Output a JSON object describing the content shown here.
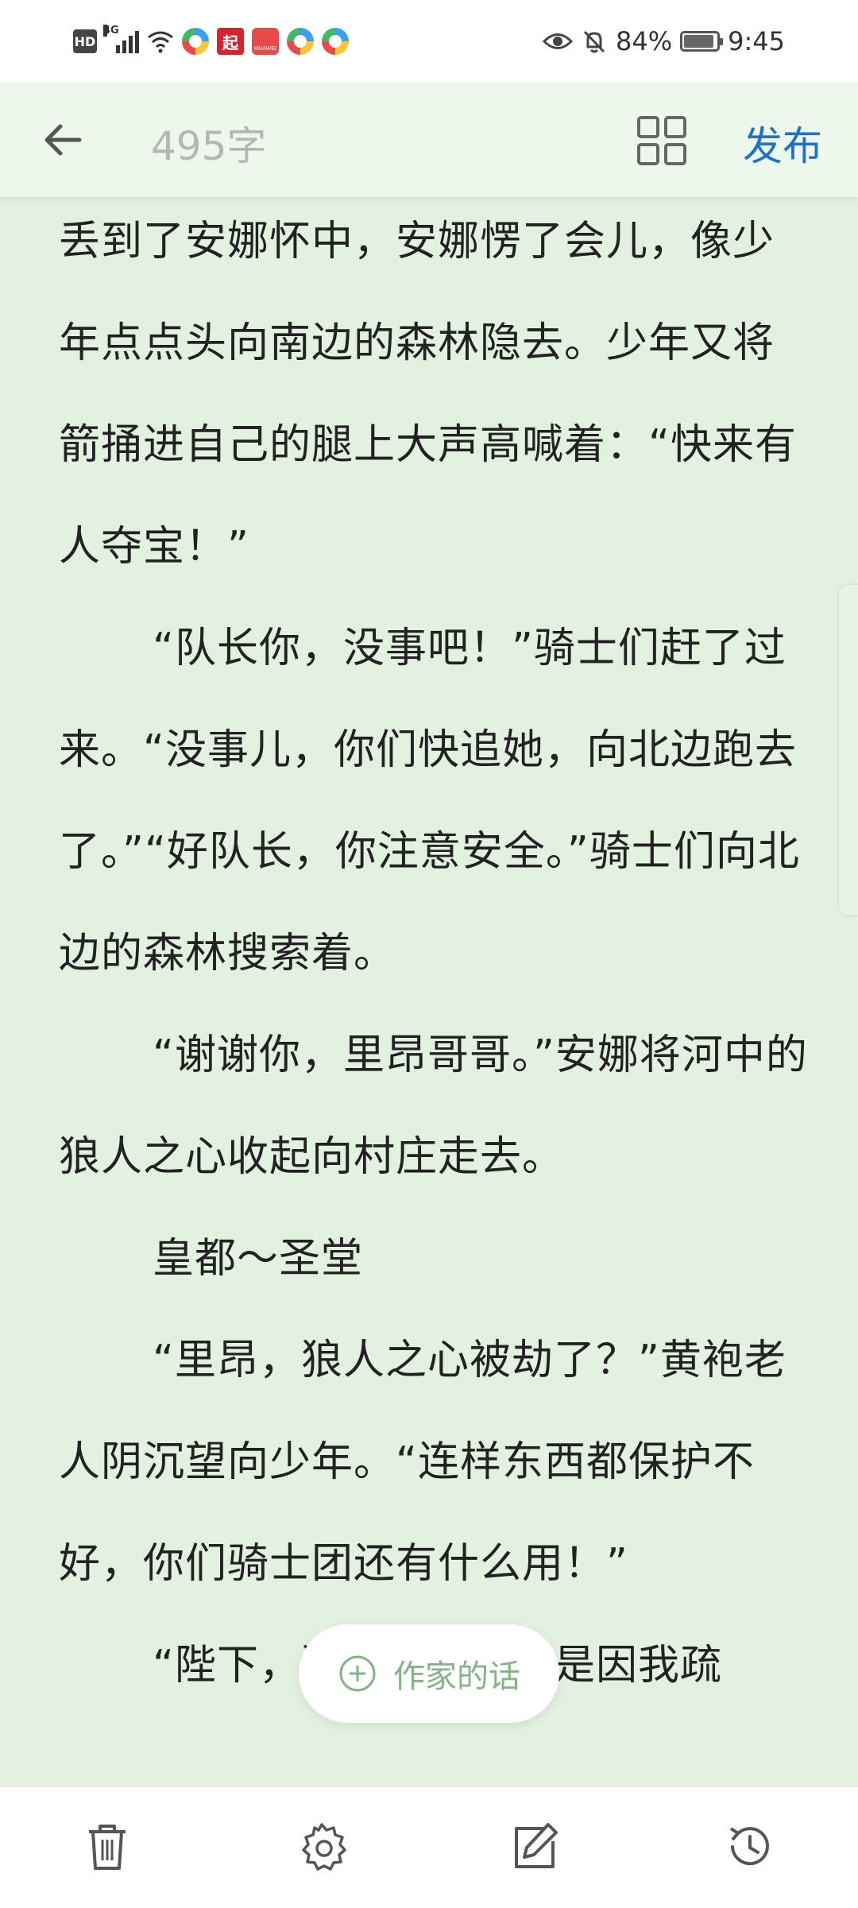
{
  "status_bar": {
    "left_icons": [
      "hd-icon",
      "signal-4g-icon",
      "wifi-icon",
      "app-icon",
      "qidian-app-icon",
      "huawei-app-icon",
      "app-icon",
      "app-icon"
    ],
    "signal_tag": "4G",
    "hd_label": "HD",
    "qidian_label": "起",
    "huawei_label": "HUAWEI",
    "battery": "84%",
    "time": "9:45",
    "right_icons": [
      "eye-icon",
      "bell-off-icon",
      "battery-icon"
    ]
  },
  "toolbar": {
    "word_count": "495字",
    "publish_label": "发布",
    "back_icon": "arrow-left-icon",
    "grid_icon": "grid-icon"
  },
  "content": {
    "paragraphs": [
      {
        "text": "丢到了安娜怀中，安娜愣了会儿，像少年点点头向南边的森林隐去。少年又将箭捅进自己的腿上大声高喊着：“快来有人夺宝！”",
        "indent": false
      },
      {
        "text": "“队长你，没事吧！”骑士们赶了过来。“没事儿，你们快追她，向北边跑去了。”“好队长，你注意安全。”骑士们向北边的森林搜索着。",
        "indent": true
      },
      {
        "text": "“谢谢你，里昂哥哥。”安娜将河中的狼人之心收起向村庄走去。",
        "indent": true
      },
      {
        "text": "皇都～圣堂",
        "indent": true
      },
      {
        "text": "“里昂，狼人之心被劫了？”黄袍老人阴沉望向少年。“连样东西都保护不好，你们骑士团还有什么用！”",
        "indent": true
      },
      {
        "text": "“陛下，狼人之心被劫是因我疏",
        "indent": true
      }
    ]
  },
  "floating": {
    "author_note_label": "作家的话",
    "icon": "plus-circle-icon"
  },
  "bottom_bar": {
    "icons": [
      "trash-icon",
      "settings-gear-icon",
      "edit-icon",
      "history-icon"
    ]
  },
  "colors": {
    "background": "#e3f1e1",
    "toolbar": "#eef7ec",
    "accent": "#1f6fcd",
    "author_note_text": "#86b386"
  }
}
